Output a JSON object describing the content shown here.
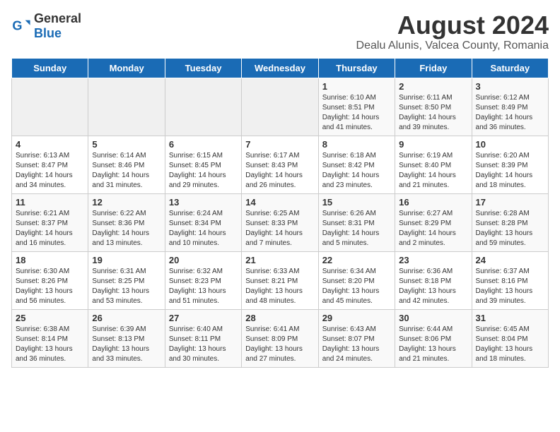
{
  "logo": {
    "general": "General",
    "blue": "Blue"
  },
  "title": "August 2024",
  "subtitle": "Dealu Alunis, Valcea County, Romania",
  "days_of_week": [
    "Sunday",
    "Monday",
    "Tuesday",
    "Wednesday",
    "Thursday",
    "Friday",
    "Saturday"
  ],
  "weeks": [
    [
      {
        "day": "",
        "info": ""
      },
      {
        "day": "",
        "info": ""
      },
      {
        "day": "",
        "info": ""
      },
      {
        "day": "",
        "info": ""
      },
      {
        "day": "1",
        "info": "Sunrise: 6:10 AM\nSunset: 8:51 PM\nDaylight: 14 hours and 41 minutes."
      },
      {
        "day": "2",
        "info": "Sunrise: 6:11 AM\nSunset: 8:50 PM\nDaylight: 14 hours and 39 minutes."
      },
      {
        "day": "3",
        "info": "Sunrise: 6:12 AM\nSunset: 8:49 PM\nDaylight: 14 hours and 36 minutes."
      }
    ],
    [
      {
        "day": "4",
        "info": "Sunrise: 6:13 AM\nSunset: 8:47 PM\nDaylight: 14 hours and 34 minutes."
      },
      {
        "day": "5",
        "info": "Sunrise: 6:14 AM\nSunset: 8:46 PM\nDaylight: 14 hours and 31 minutes."
      },
      {
        "day": "6",
        "info": "Sunrise: 6:15 AM\nSunset: 8:45 PM\nDaylight: 14 hours and 29 minutes."
      },
      {
        "day": "7",
        "info": "Sunrise: 6:17 AM\nSunset: 8:43 PM\nDaylight: 14 hours and 26 minutes."
      },
      {
        "day": "8",
        "info": "Sunrise: 6:18 AM\nSunset: 8:42 PM\nDaylight: 14 hours and 23 minutes."
      },
      {
        "day": "9",
        "info": "Sunrise: 6:19 AM\nSunset: 8:40 PM\nDaylight: 14 hours and 21 minutes."
      },
      {
        "day": "10",
        "info": "Sunrise: 6:20 AM\nSunset: 8:39 PM\nDaylight: 14 hours and 18 minutes."
      }
    ],
    [
      {
        "day": "11",
        "info": "Sunrise: 6:21 AM\nSunset: 8:37 PM\nDaylight: 14 hours and 16 minutes."
      },
      {
        "day": "12",
        "info": "Sunrise: 6:22 AM\nSunset: 8:36 PM\nDaylight: 14 hours and 13 minutes."
      },
      {
        "day": "13",
        "info": "Sunrise: 6:24 AM\nSunset: 8:34 PM\nDaylight: 14 hours and 10 minutes."
      },
      {
        "day": "14",
        "info": "Sunrise: 6:25 AM\nSunset: 8:33 PM\nDaylight: 14 hours and 7 minutes."
      },
      {
        "day": "15",
        "info": "Sunrise: 6:26 AM\nSunset: 8:31 PM\nDaylight: 14 hours and 5 minutes."
      },
      {
        "day": "16",
        "info": "Sunrise: 6:27 AM\nSunset: 8:29 PM\nDaylight: 14 hours and 2 minutes."
      },
      {
        "day": "17",
        "info": "Sunrise: 6:28 AM\nSunset: 8:28 PM\nDaylight: 13 hours and 59 minutes."
      }
    ],
    [
      {
        "day": "18",
        "info": "Sunrise: 6:30 AM\nSunset: 8:26 PM\nDaylight: 13 hours and 56 minutes."
      },
      {
        "day": "19",
        "info": "Sunrise: 6:31 AM\nSunset: 8:25 PM\nDaylight: 13 hours and 53 minutes."
      },
      {
        "day": "20",
        "info": "Sunrise: 6:32 AM\nSunset: 8:23 PM\nDaylight: 13 hours and 51 minutes."
      },
      {
        "day": "21",
        "info": "Sunrise: 6:33 AM\nSunset: 8:21 PM\nDaylight: 13 hours and 48 minutes."
      },
      {
        "day": "22",
        "info": "Sunrise: 6:34 AM\nSunset: 8:20 PM\nDaylight: 13 hours and 45 minutes."
      },
      {
        "day": "23",
        "info": "Sunrise: 6:36 AM\nSunset: 8:18 PM\nDaylight: 13 hours and 42 minutes."
      },
      {
        "day": "24",
        "info": "Sunrise: 6:37 AM\nSunset: 8:16 PM\nDaylight: 13 hours and 39 minutes."
      }
    ],
    [
      {
        "day": "25",
        "info": "Sunrise: 6:38 AM\nSunset: 8:14 PM\nDaylight: 13 hours and 36 minutes."
      },
      {
        "day": "26",
        "info": "Sunrise: 6:39 AM\nSunset: 8:13 PM\nDaylight: 13 hours and 33 minutes."
      },
      {
        "day": "27",
        "info": "Sunrise: 6:40 AM\nSunset: 8:11 PM\nDaylight: 13 hours and 30 minutes."
      },
      {
        "day": "28",
        "info": "Sunrise: 6:41 AM\nSunset: 8:09 PM\nDaylight: 13 hours and 27 minutes."
      },
      {
        "day": "29",
        "info": "Sunrise: 6:43 AM\nSunset: 8:07 PM\nDaylight: 13 hours and 24 minutes."
      },
      {
        "day": "30",
        "info": "Sunrise: 6:44 AM\nSunset: 8:06 PM\nDaylight: 13 hours and 21 minutes."
      },
      {
        "day": "31",
        "info": "Sunrise: 6:45 AM\nSunset: 8:04 PM\nDaylight: 13 hours and 18 minutes."
      }
    ]
  ]
}
